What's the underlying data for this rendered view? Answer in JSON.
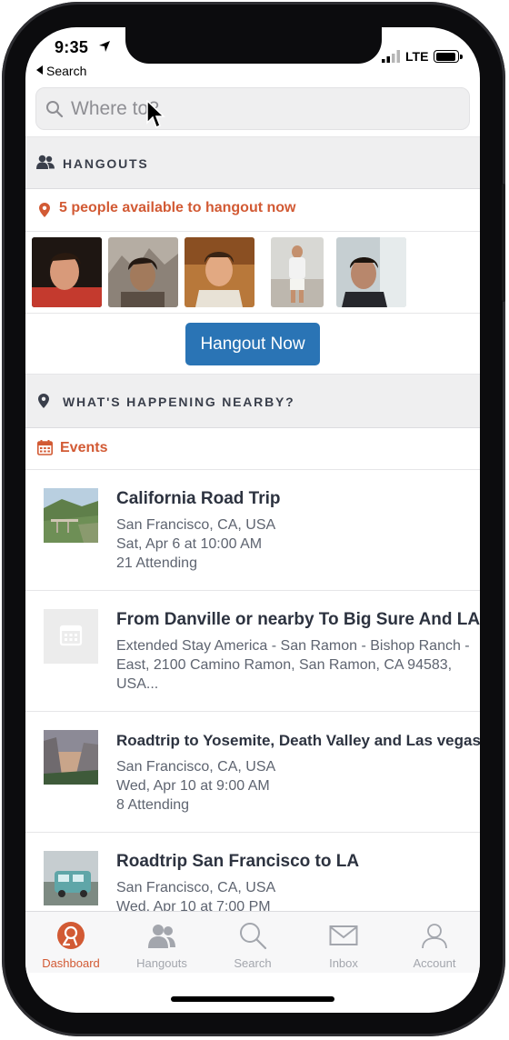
{
  "status": {
    "time": "9:35",
    "back_label": "Search",
    "network": "LTE"
  },
  "search": {
    "placeholder": "Where to?"
  },
  "hangouts": {
    "header": "HANGOUTS",
    "available_text": "5 people available to hangout now",
    "button_label": "Hangout Now",
    "avatars": [
      {
        "name": "avatar-1",
        "bg": "#2a1c18",
        "skin": "#d89a7a",
        "shirt": "#c43a2e"
      },
      {
        "name": "avatar-2",
        "bg": "#9a8f84",
        "skin": "#a27a5c",
        "shirt": "#5a4e44"
      },
      {
        "name": "avatar-3",
        "bg": "#b8783a",
        "skin": "#e2a982",
        "shirt": "#e8e2d6"
      },
      {
        "name": "avatar-4",
        "bg": "#cfcfcc",
        "skin": "#c4906e",
        "shirt": "#f2f2f2"
      },
      {
        "name": "avatar-5",
        "bg": "#c6cfd2",
        "skin": "#b8876c",
        "shirt": "#26272c"
      }
    ]
  },
  "nearby": {
    "header": "WHAT'S HAPPENING NEARBY?",
    "events_label": "Events",
    "events": [
      {
        "title": "California Road Trip",
        "lines": [
          "San Francisco, CA, USA",
          "Sat, Apr 6 at 10:00 AM",
          "21 Attending"
        ],
        "thumb": "coast"
      },
      {
        "title": "From Danville or nearby To Big Sure And LA",
        "lines": [
          "Extended Stay America - San Ramon - Bishop Ranch -",
          "East, 2100 Camino Ramon, San Ramon, CA 94583,",
          "USA..."
        ],
        "thumb": "placeholder"
      },
      {
        "title": "Roadtrip to Yosemite, Death Valley and Las vegas",
        "lines": [
          "San Francisco, CA, USA",
          "Wed, Apr 10 at 9:00 AM",
          "8 Attending"
        ],
        "thumb": "valley"
      },
      {
        "title": "Roadtrip San Francisco to LA",
        "lines": [
          "San Francisco, CA, USA",
          "Wed, Apr 10 at 7:00 PM"
        ],
        "thumb": "van"
      }
    ]
  },
  "tabs": [
    {
      "label": "Dashboard",
      "icon": "dashboard-icon",
      "active": true
    },
    {
      "label": "Hangouts",
      "icon": "people-icon",
      "active": false
    },
    {
      "label": "Search",
      "icon": "search-icon",
      "active": false
    },
    {
      "label": "Inbox",
      "icon": "mail-icon",
      "active": false
    },
    {
      "label": "Account",
      "icon": "user-icon",
      "active": false
    }
  ],
  "colors": {
    "accent": "#d25a34",
    "button": "#2a74b5",
    "text_dark": "#2d3340",
    "section_bg": "#efeff0"
  }
}
